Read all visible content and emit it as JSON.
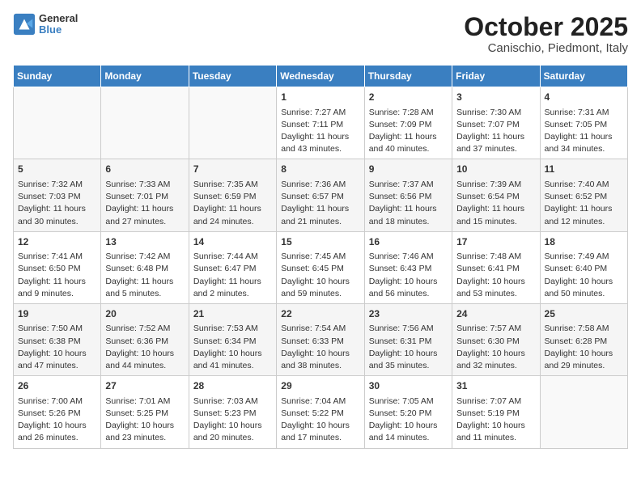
{
  "header": {
    "logo_line1": "General",
    "logo_line2": "Blue",
    "title": "October 2025",
    "subtitle": "Canischio, Piedmont, Italy"
  },
  "columns": [
    "Sunday",
    "Monday",
    "Tuesday",
    "Wednesday",
    "Thursday",
    "Friday",
    "Saturday"
  ],
  "weeks": [
    [
      {
        "day": "",
        "info": ""
      },
      {
        "day": "",
        "info": ""
      },
      {
        "day": "",
        "info": ""
      },
      {
        "day": "1",
        "info": "Sunrise: 7:27 AM\nSunset: 7:11 PM\nDaylight: 11 hours\nand 43 minutes."
      },
      {
        "day": "2",
        "info": "Sunrise: 7:28 AM\nSunset: 7:09 PM\nDaylight: 11 hours\nand 40 minutes."
      },
      {
        "day": "3",
        "info": "Sunrise: 7:30 AM\nSunset: 7:07 PM\nDaylight: 11 hours\nand 37 minutes."
      },
      {
        "day": "4",
        "info": "Sunrise: 7:31 AM\nSunset: 7:05 PM\nDaylight: 11 hours\nand 34 minutes."
      }
    ],
    [
      {
        "day": "5",
        "info": "Sunrise: 7:32 AM\nSunset: 7:03 PM\nDaylight: 11 hours\nand 30 minutes."
      },
      {
        "day": "6",
        "info": "Sunrise: 7:33 AM\nSunset: 7:01 PM\nDaylight: 11 hours\nand 27 minutes."
      },
      {
        "day": "7",
        "info": "Sunrise: 7:35 AM\nSunset: 6:59 PM\nDaylight: 11 hours\nand 24 minutes."
      },
      {
        "day": "8",
        "info": "Sunrise: 7:36 AM\nSunset: 6:57 PM\nDaylight: 11 hours\nand 21 minutes."
      },
      {
        "day": "9",
        "info": "Sunrise: 7:37 AM\nSunset: 6:56 PM\nDaylight: 11 hours\nand 18 minutes."
      },
      {
        "day": "10",
        "info": "Sunrise: 7:39 AM\nSunset: 6:54 PM\nDaylight: 11 hours\nand 15 minutes."
      },
      {
        "day": "11",
        "info": "Sunrise: 7:40 AM\nSunset: 6:52 PM\nDaylight: 11 hours\nand 12 minutes."
      }
    ],
    [
      {
        "day": "12",
        "info": "Sunrise: 7:41 AM\nSunset: 6:50 PM\nDaylight: 11 hours\nand 9 minutes."
      },
      {
        "day": "13",
        "info": "Sunrise: 7:42 AM\nSunset: 6:48 PM\nDaylight: 11 hours\nand 5 minutes."
      },
      {
        "day": "14",
        "info": "Sunrise: 7:44 AM\nSunset: 6:47 PM\nDaylight: 11 hours\nand 2 minutes."
      },
      {
        "day": "15",
        "info": "Sunrise: 7:45 AM\nSunset: 6:45 PM\nDaylight: 10 hours\nand 59 minutes."
      },
      {
        "day": "16",
        "info": "Sunrise: 7:46 AM\nSunset: 6:43 PM\nDaylight: 10 hours\nand 56 minutes."
      },
      {
        "day": "17",
        "info": "Sunrise: 7:48 AM\nSunset: 6:41 PM\nDaylight: 10 hours\nand 53 minutes."
      },
      {
        "day": "18",
        "info": "Sunrise: 7:49 AM\nSunset: 6:40 PM\nDaylight: 10 hours\nand 50 minutes."
      }
    ],
    [
      {
        "day": "19",
        "info": "Sunrise: 7:50 AM\nSunset: 6:38 PM\nDaylight: 10 hours\nand 47 minutes."
      },
      {
        "day": "20",
        "info": "Sunrise: 7:52 AM\nSunset: 6:36 PM\nDaylight: 10 hours\nand 44 minutes."
      },
      {
        "day": "21",
        "info": "Sunrise: 7:53 AM\nSunset: 6:34 PM\nDaylight: 10 hours\nand 41 minutes."
      },
      {
        "day": "22",
        "info": "Sunrise: 7:54 AM\nSunset: 6:33 PM\nDaylight: 10 hours\nand 38 minutes."
      },
      {
        "day": "23",
        "info": "Sunrise: 7:56 AM\nSunset: 6:31 PM\nDaylight: 10 hours\nand 35 minutes."
      },
      {
        "day": "24",
        "info": "Sunrise: 7:57 AM\nSunset: 6:30 PM\nDaylight: 10 hours\nand 32 minutes."
      },
      {
        "day": "25",
        "info": "Sunrise: 7:58 AM\nSunset: 6:28 PM\nDaylight: 10 hours\nand 29 minutes."
      }
    ],
    [
      {
        "day": "26",
        "info": "Sunrise: 7:00 AM\nSunset: 5:26 PM\nDaylight: 10 hours\nand 26 minutes."
      },
      {
        "day": "27",
        "info": "Sunrise: 7:01 AM\nSunset: 5:25 PM\nDaylight: 10 hours\nand 23 minutes."
      },
      {
        "day": "28",
        "info": "Sunrise: 7:03 AM\nSunset: 5:23 PM\nDaylight: 10 hours\nand 20 minutes."
      },
      {
        "day": "29",
        "info": "Sunrise: 7:04 AM\nSunset: 5:22 PM\nDaylight: 10 hours\nand 17 minutes."
      },
      {
        "day": "30",
        "info": "Sunrise: 7:05 AM\nSunset: 5:20 PM\nDaylight: 10 hours\nand 14 minutes."
      },
      {
        "day": "31",
        "info": "Sunrise: 7:07 AM\nSunset: 5:19 PM\nDaylight: 10 hours\nand 11 minutes."
      },
      {
        "day": "",
        "info": ""
      }
    ]
  ]
}
